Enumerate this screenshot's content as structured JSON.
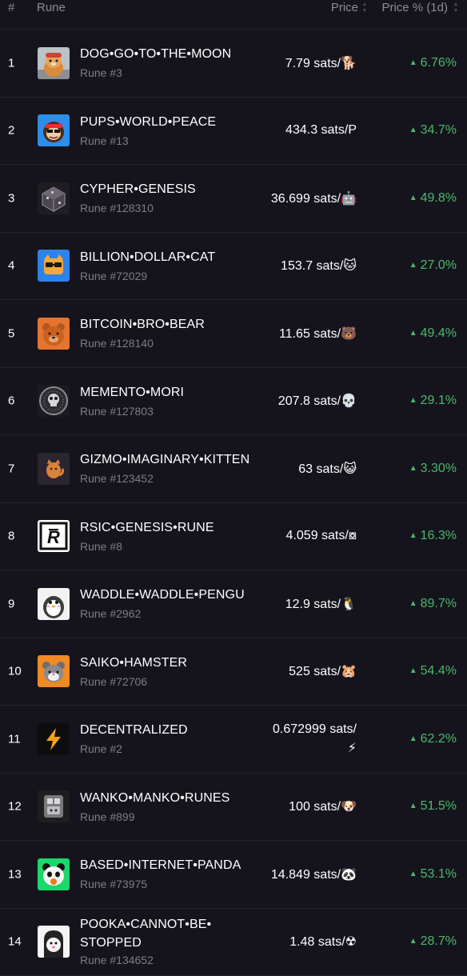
{
  "header": {
    "num": "#",
    "rune": "Rune",
    "price": "Price",
    "change": "Price % (1d)"
  },
  "colors": {
    "background": "#15141d",
    "positive": "#4cb86b",
    "muted": "#7e7c88"
  },
  "rows": [
    {
      "num": "1",
      "name": "DOG•GO•TO•THE•MOON",
      "sub": "Rune #3",
      "price": "7.79 sats/🐕",
      "change": "6.76%",
      "logo": "shiba-dog-logo"
    },
    {
      "num": "2",
      "name": "PUPS•WORLD•PEACE",
      "sub": "Rune #13",
      "price": "434.3 sats/P",
      "change": "34.7%",
      "logo": "pups-monkey-logo"
    },
    {
      "num": "3",
      "name": "CYPHER•GENESIS",
      "sub": "Rune #128310",
      "price": "36.699 sats/🤖",
      "change": "49.8%",
      "logo": "cypher-cube-logo"
    },
    {
      "num": "4",
      "name": "BILLION•DOLLAR•CAT",
      "sub": "Rune #72029",
      "price": "153.7 sats/🐱",
      "change": "27.0%",
      "logo": "cat-glasses-logo"
    },
    {
      "num": "5",
      "name": "BITCOIN•BRO•BEAR",
      "sub": "Rune #128140",
      "price": "11.65 sats/🐻",
      "change": "49.4%",
      "logo": "bear-logo"
    },
    {
      "num": "6",
      "name": "MEMENTO•MORI",
      "sub": "Rune #127803",
      "price": "207.8 sats/💀",
      "change": "29.1%",
      "logo": "skull-coin-logo"
    },
    {
      "num": "7",
      "name": "GIZMO•IMAGINARY•KITTEN",
      "sub": "Rune #123452",
      "price": "63 sats/😺",
      "change": "3.30%",
      "logo": "kitten-logo"
    },
    {
      "num": "8",
      "name": "RSIC•GENESIS•RUNE",
      "sub": "Rune #8",
      "price": "4.059 sats/⧇",
      "change": "16.3%",
      "logo": "rsic-logo"
    },
    {
      "num": "9",
      "name": "WADDLE•WADDLE•PENGU",
      "sub": "Rune #2962",
      "price": "12.9 sats/🐧",
      "change": "89.7%",
      "logo": "penguin-logo"
    },
    {
      "num": "10",
      "name": "SAIKO•HAMSTER",
      "sub": "Rune #72706",
      "price": "525 sats/🐹",
      "change": "54.4%",
      "logo": "hamster-logo"
    },
    {
      "num": "11",
      "name": "DECENTRALIZED",
      "sub": "Rune #2",
      "price": "0.672999 sats/",
      "price2": "⚡",
      "change": "62.2%",
      "logo": "lightning-logo"
    },
    {
      "num": "12",
      "name": "WANKO•MANKO•RUNES",
      "sub": "Rune #899",
      "price": "100 sats/🐶",
      "change": "51.5%",
      "logo": "wanko-logo"
    },
    {
      "num": "13",
      "name": "BASED•INTERNET•PANDA",
      "sub": "Rune #73975",
      "price": "14.849 sats/🐼",
      "change": "53.1%",
      "logo": "panda-logo"
    },
    {
      "num": "14",
      "name": "POOKA•CANNOT•BE•",
      "name2": "STOPPED",
      "sub": "Rune #134652",
      "price": "1.48 sats/☢",
      "change": "28.7%",
      "logo": "pooka-logo"
    }
  ]
}
